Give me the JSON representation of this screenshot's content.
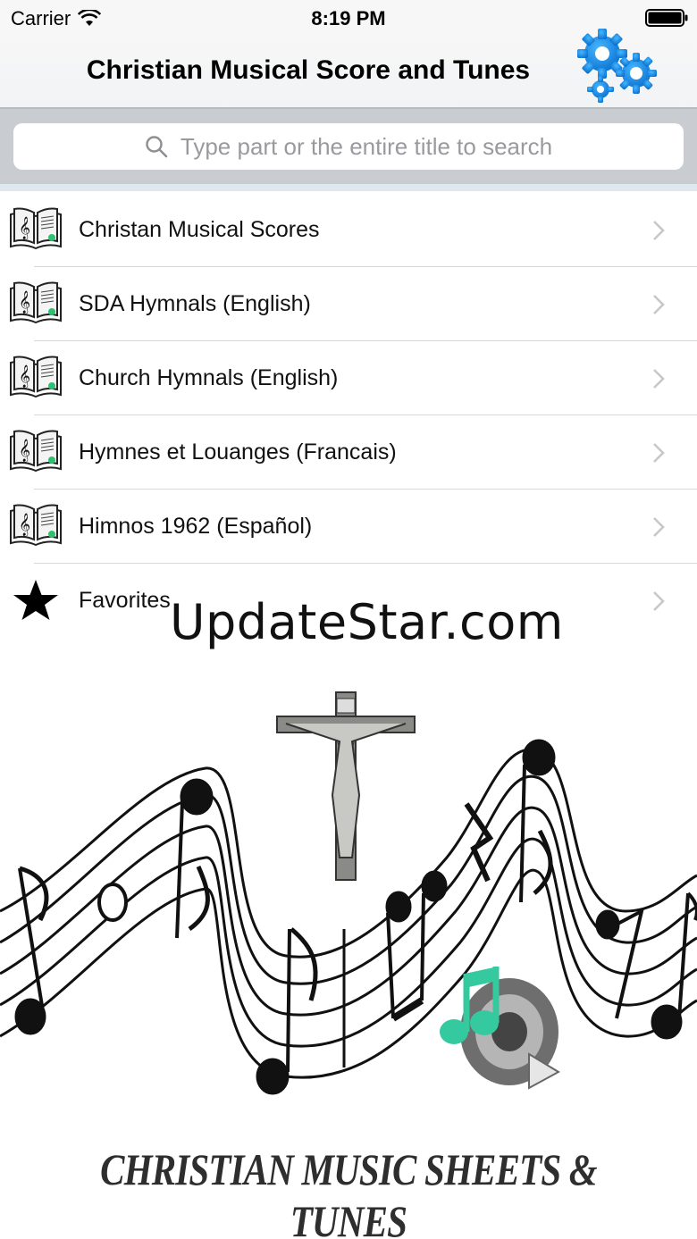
{
  "status_bar": {
    "carrier": "Carrier",
    "time": "8:19 PM",
    "icons": [
      "wifi-icon",
      "battery-icon"
    ]
  },
  "nav": {
    "title": "Christian Musical Score and Tunes",
    "settings_icon": "gears-icon",
    "accent_color": "#1e8fe1"
  },
  "search": {
    "placeholder": "Type part or the entire title to search"
  },
  "list": {
    "items": [
      {
        "label": "Christan Musical Scores",
        "icon": "music-book-icon"
      },
      {
        "label": "SDA Hymnals (English)",
        "icon": "music-book-icon"
      },
      {
        "label": "Church Hymnals (English)",
        "icon": "music-book-icon"
      },
      {
        "label": "Hymnes et Louanges (Francais)",
        "icon": "music-book-icon"
      },
      {
        "label": "Himnos 1962 (Español)",
        "icon": "music-book-icon"
      },
      {
        "label": "Favorites",
        "icon": "star-icon"
      }
    ]
  },
  "watermark": "UpdateStar.com",
  "banner": {
    "text": "CHRISTIAN MUSIC SHEETS  & TUNES"
  }
}
